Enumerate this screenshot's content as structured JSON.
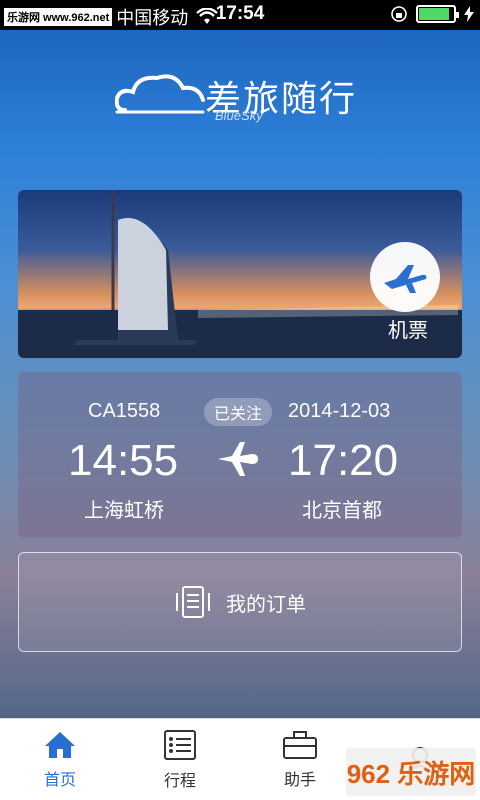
{
  "status_bar": {
    "watermark": "乐游网 www.962.net",
    "carrier": "中国移动",
    "time": "17:54"
  },
  "logo": {
    "title": "差旅随行",
    "subtitle": "BlueSky"
  },
  "banner": {
    "label": "机票"
  },
  "flight": {
    "number": "CA1558",
    "badge": "已关注",
    "date": "2014-12-03",
    "depart_time": "14:55",
    "arrive_time": "17:20",
    "depart_city": "上海虹桥",
    "arrive_city": "北京首都"
  },
  "orders": {
    "label": "我的订单"
  },
  "tabs": [
    {
      "label": "首页",
      "icon": "home-icon"
    },
    {
      "label": "行程",
      "icon": "list-icon"
    },
    {
      "label": "助手",
      "icon": "briefcase-icon"
    }
  ],
  "corner_watermark": "962 乐游网",
  "colors": {
    "accent": "#2a6fd0",
    "battery": "#4cd964"
  }
}
